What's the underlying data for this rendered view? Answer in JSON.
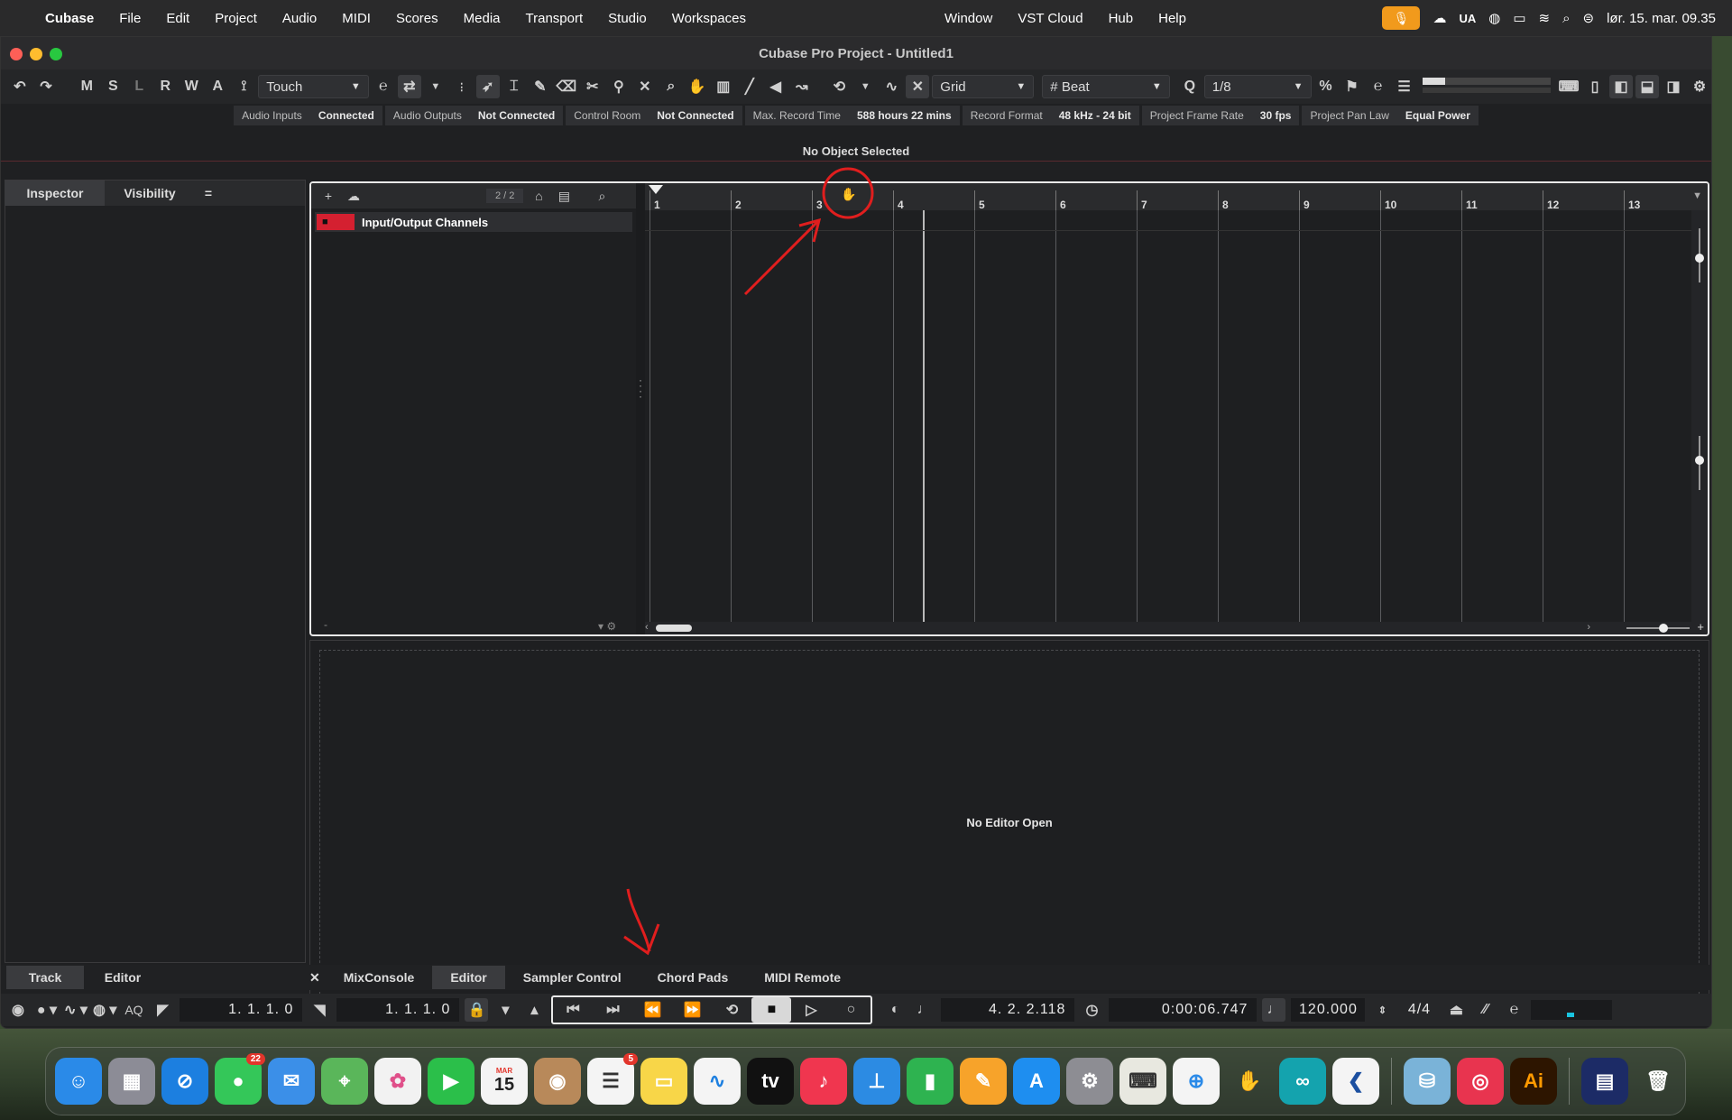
{
  "menubar": {
    "app": "Cubase",
    "items": [
      "File",
      "Edit",
      "Project",
      "Audio",
      "MIDI",
      "Scores",
      "Media",
      "Transport",
      "Studio",
      "Workspaces"
    ],
    "right_items": [
      "Window",
      "VST Cloud",
      "Hub",
      "Help"
    ],
    "input_source": "UA",
    "datetime": "lør. 15. mar. 09.35"
  },
  "window": {
    "title": "Cubase Pro Project - Untitled1"
  },
  "toolbar": {
    "buttons": [
      "M",
      "S",
      "L",
      "R",
      "W",
      "A"
    ],
    "automation_mode": "Touch",
    "snap_type": "Grid",
    "grid_type": "Beat",
    "quantize": "1/8"
  },
  "status": {
    "audio_inputs_label": "Audio Inputs",
    "audio_inputs_value": "Connected",
    "audio_outputs_label": "Audio Outputs",
    "audio_outputs_value": "Not Connected",
    "control_room_label": "Control Room",
    "control_room_value": "Not Connected",
    "max_record_label": "Max. Record Time",
    "max_record_value": "588 hours 22 mins",
    "record_format_label": "Record Format",
    "record_format_value": "48 kHz - 24 bit",
    "frame_rate_label": "Project Frame Rate",
    "frame_rate_value": "30 fps",
    "pan_law_label": "Project Pan Law",
    "pan_law_value": "Equal Power"
  },
  "info_line": "No Object Selected",
  "left_zone": {
    "tabs": [
      "Inspector",
      "Visibility"
    ],
    "menu_glyph": "=",
    "bottom_tabs": [
      "Track",
      "Editor"
    ]
  },
  "project": {
    "track_counter": "2 / 2",
    "tracks": [
      {
        "name": "Input/Output Channels",
        "color": "#d42030"
      }
    ],
    "ruler_bars": [
      "1",
      "2",
      "3",
      "4",
      "5",
      "6",
      "7",
      "8",
      "9",
      "10",
      "11",
      "12",
      "13"
    ]
  },
  "lower_zone": {
    "empty_text": "No Editor Open",
    "tabs": [
      "MixConsole",
      "Editor",
      "Sampler Control",
      "Chord Pads",
      "MIDI Remote"
    ],
    "active_tab": "Editor"
  },
  "transport": {
    "aq_label": "AQ",
    "left_locator": "1.  1.  1.    0",
    "right_locator": "1.  1.  1.    0",
    "position_bars": "4.  2.  2.118",
    "position_time": "0:00:06.747",
    "tempo": "120.000",
    "signature": "4/4"
  },
  "dock": {
    "apps": [
      {
        "name": "finder",
        "glyph": "☺",
        "color": "#2a8ae8"
      },
      {
        "name": "launchpad",
        "glyph": "▦",
        "color": "#8c8c96"
      },
      {
        "name": "safari",
        "glyph": "⊘",
        "color": "#1c7fe0"
      },
      {
        "name": "messages",
        "glyph": "●",
        "color": "#34c759",
        "badge": "22"
      },
      {
        "name": "mail",
        "glyph": "✉",
        "color": "#3b8fe8"
      },
      {
        "name": "maps",
        "glyph": "⌖",
        "color": "#5ab65a"
      },
      {
        "name": "photos",
        "glyph": "✿",
        "color": "#f2f2f2"
      },
      {
        "name": "facetime",
        "glyph": "▶",
        "color": "#2bbf4a"
      },
      {
        "name": "calendar",
        "glyph": "15",
        "color": "#f4f4f4",
        "month": "MAR"
      },
      {
        "name": "contacts",
        "glyph": "◉",
        "color": "#b8895a"
      },
      {
        "name": "reminders",
        "glyph": "☰",
        "color": "#f4f4f4",
        "badge": "5"
      },
      {
        "name": "notes",
        "glyph": "▭",
        "color": "#f8d648"
      },
      {
        "name": "freeform",
        "glyph": "∿",
        "color": "#f4f4f4"
      },
      {
        "name": "apple-tv",
        "glyph": "tv",
        "color": "#111111"
      },
      {
        "name": "music",
        "glyph": "♪",
        "color": "#f0364f"
      },
      {
        "name": "keynote",
        "glyph": "⊥",
        "color": "#2c8be3"
      },
      {
        "name": "numbers",
        "glyph": "▮",
        "color": "#2eb350"
      },
      {
        "name": "pages",
        "glyph": "✎",
        "color": "#f7a32a"
      },
      {
        "name": "app-store",
        "glyph": "A",
        "color": "#1e8ef0"
      },
      {
        "name": "system-settings",
        "glyph": "⚙",
        "color": "#8d8d93"
      },
      {
        "name": "keyboard-app",
        "glyph": "⌨",
        "color": "#e8e8e0"
      },
      {
        "name": "connect-app",
        "glyph": "⊕",
        "color": "#f4f4f4"
      },
      {
        "name": "hand-app",
        "glyph": "✋",
        "color": "#e06a2a"
      },
      {
        "name": "arduino",
        "glyph": "∞",
        "color": "#14a3ae"
      },
      {
        "name": "cubase",
        "glyph": "❮",
        "color": "#f4f4f4"
      },
      {
        "name": "drive",
        "glyph": "⛁",
        "color": "#7ab3d8"
      },
      {
        "name": "creative-cloud",
        "glyph": "◎",
        "color": "#e8344f"
      },
      {
        "name": "illustrator",
        "glyph": "Ai",
        "color": "#2d1500"
      },
      {
        "name": "document",
        "glyph": "▤",
        "color": "#1c2b66"
      },
      {
        "name": "trash",
        "glyph": "🗑",
        "color": "#9a9ea2"
      }
    ]
  },
  "colors": {
    "annotation": "#e01e1e",
    "track_folder": "#d42030",
    "accent_mic": "#f19a1c"
  }
}
